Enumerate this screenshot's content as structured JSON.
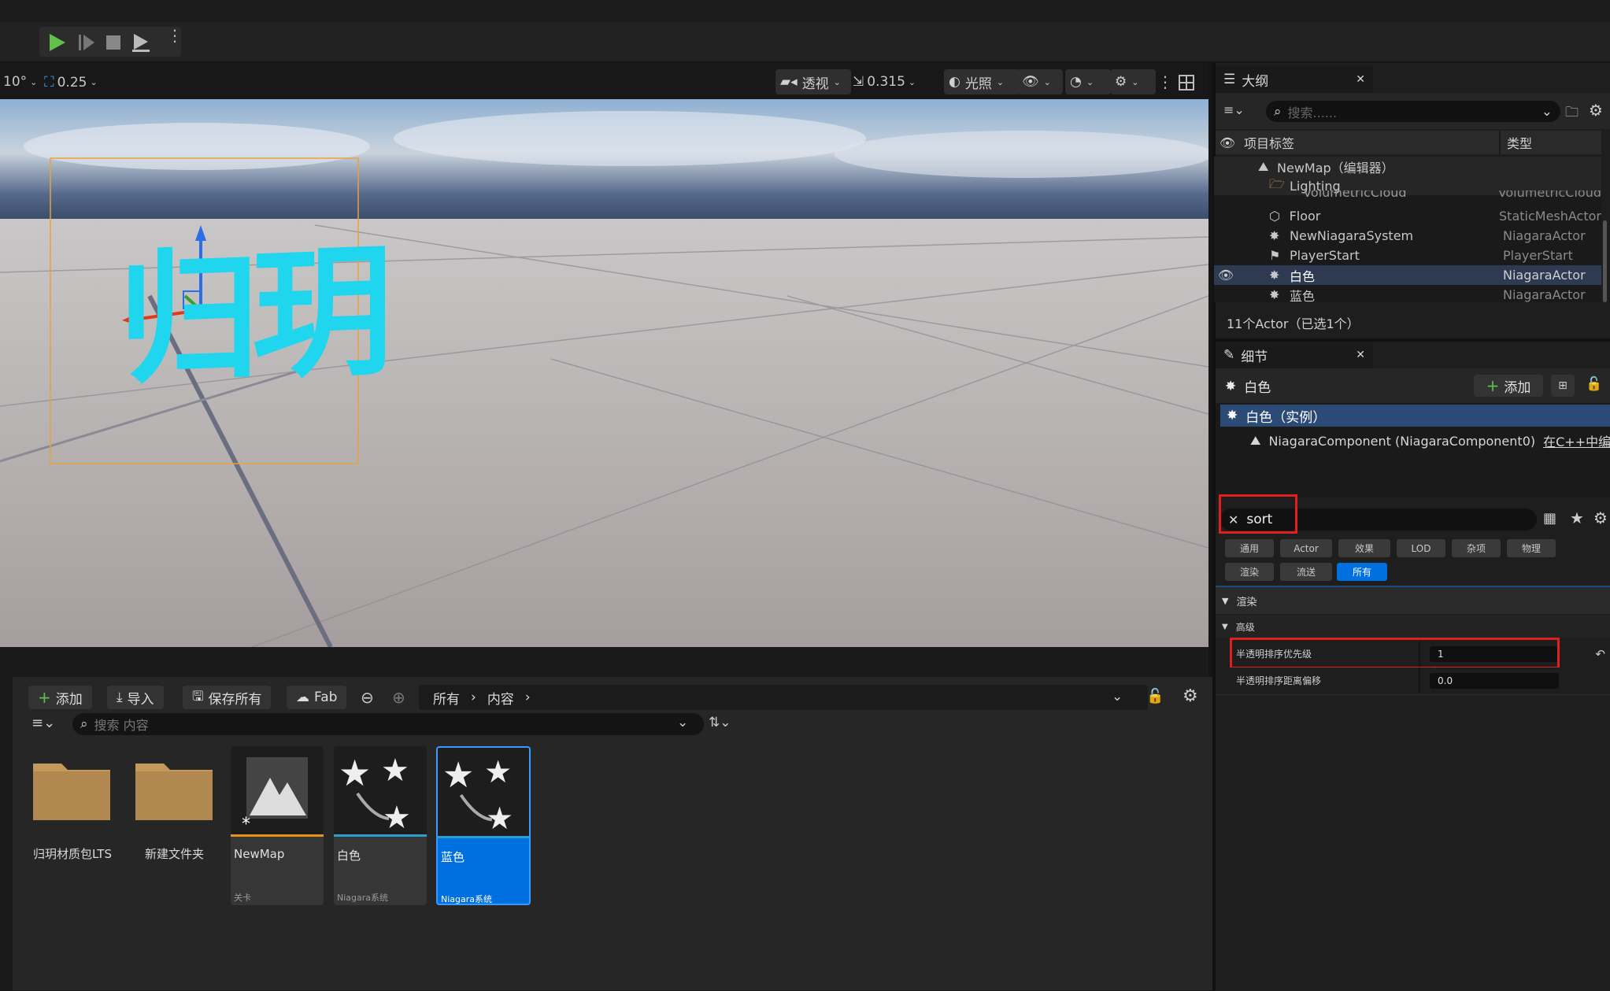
{
  "toolbar": {
    "rotation_snap": "10°",
    "scale_snap": "0.25",
    "perspective_label": "透视",
    "camera_speed": "0.315",
    "lighting_label": "光照"
  },
  "outliner": {
    "tab_title": "大纲",
    "search_placeholder": "搜索......",
    "col_label": "项目标签",
    "col_type": "类型",
    "items": [
      {
        "label": "NewMap（编辑器）",
        "type": ""
      },
      {
        "label": "Lighting",
        "type": ""
      },
      {
        "label": "VolumetricCloud",
        "type": "VolumetricCloud"
      },
      {
        "label": "Floor",
        "type": "StaticMeshActor"
      },
      {
        "label": "NewNiagaraSystem",
        "type": "NiagaraActor"
      },
      {
        "label": "PlayerStart",
        "type": "PlayerStart"
      },
      {
        "label": "白色",
        "type": "NiagaraActor"
      },
      {
        "label": "蓝色",
        "type": "NiagaraActor"
      }
    ],
    "status": "11个Actor（已选1个）"
  },
  "details": {
    "tab_title": "细节",
    "actor_name": "白色",
    "add_label": "添加",
    "instance_label": "白色（实例）",
    "component_label": "NiagaraComponent (NiagaraComponent0)",
    "component_link": "在C++中编辑",
    "search_value": "sort",
    "filters": [
      "通用",
      "Actor",
      "效果",
      "LOD",
      "杂项",
      "物理",
      "渲染",
      "流送",
      "所有"
    ],
    "active_filter": "所有",
    "section_render": "渲染",
    "section_advanced": "高级",
    "props": [
      {
        "label": "半透明排序优先级",
        "value": "1"
      },
      {
        "label": "半透明排序距离偏移",
        "value": "0.0"
      }
    ]
  },
  "content_browser": {
    "add_label": "添加",
    "import_label": "导入",
    "save_all_label": "保存所有",
    "fab_label": "Fab",
    "path": [
      "所有",
      "内容"
    ],
    "search_placeholder": "搜索 内容",
    "assets": [
      {
        "name": "归玥材质包LTS",
        "type": ""
      },
      {
        "name": "新建文件夹",
        "type": ""
      },
      {
        "name": "NewMap",
        "type": "关卡"
      },
      {
        "name": "白色",
        "type": "Niagara系统"
      },
      {
        "name": "蓝色",
        "type": "Niagara系统"
      }
    ]
  },
  "viewport": {
    "scene_text": "归玥"
  },
  "colors": {
    "accent": "#0070e0",
    "highlight_red": "#e02020",
    "play_green": "#5fc04a",
    "scene_text_cyan": "#1fd6ee"
  }
}
